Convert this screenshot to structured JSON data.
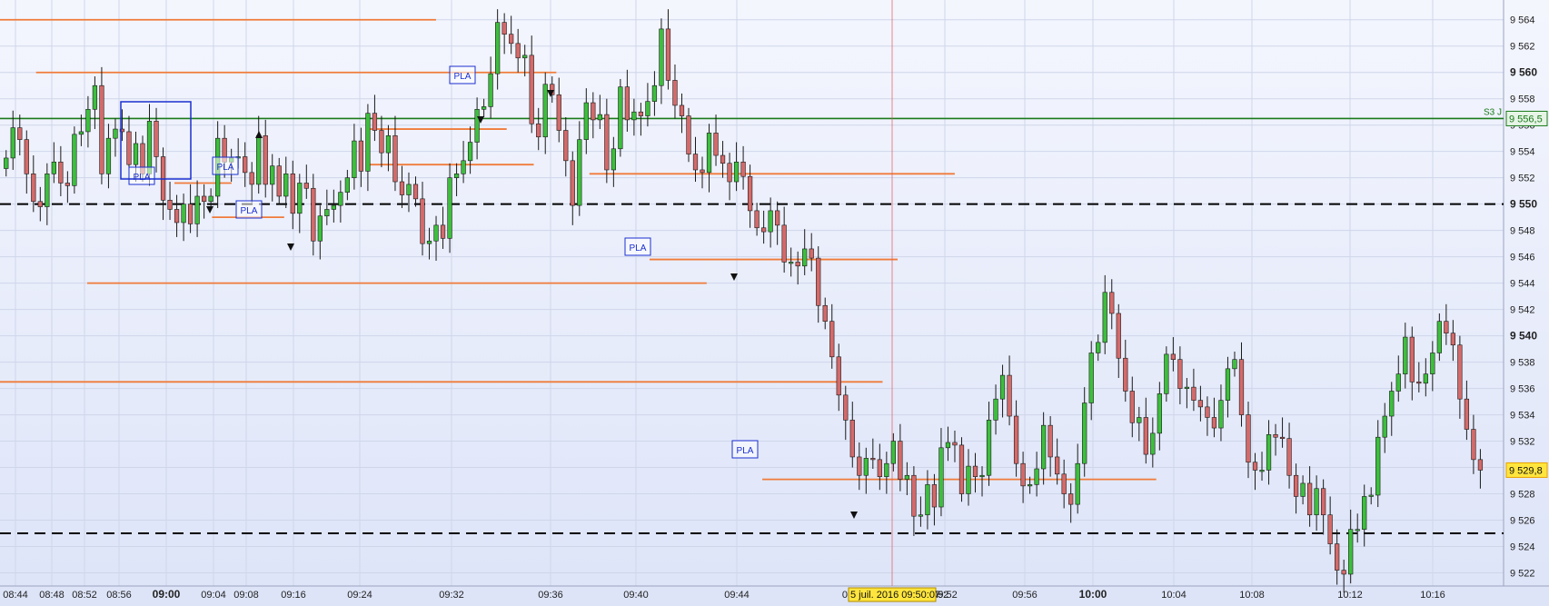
{
  "chart_data": {
    "type": "candlestick",
    "ylim": [
      9521,
      9565.5
    ],
    "y_ticks": [
      9522,
      9524,
      9526,
      9528,
      9530,
      9532,
      9534,
      9536,
      9538,
      9540,
      9542,
      9544,
      9546,
      9548,
      9550,
      9552,
      9554,
      9556,
      9558,
      9560,
      9562,
      9564
    ],
    "y_tick_labels": [
      "9 522",
      "9 524",
      "9 526",
      "9 528",
      "9 530",
      "9 532",
      "9 534",
      "9 536",
      "9 538",
      "9 540",
      "9 542",
      "9 544",
      "9 546",
      "9 548",
      "9 550",
      "9 552",
      "9 554",
      "9 556",
      "9 558",
      "9 560",
      "9 562",
      "9 564"
    ],
    "y_bold_ticks": [
      9540,
      9550,
      9560
    ],
    "x_tick_labels": [
      {
        "label": "08:44",
        "bold": false
      },
      {
        "label": "08:48",
        "bold": false
      },
      {
        "label": "08:52",
        "bold": false
      },
      {
        "label": "08:56",
        "bold": false
      },
      {
        "label": "09:00",
        "bold": true
      },
      {
        "label": "09:04",
        "bold": false
      },
      {
        "label": "09:08",
        "bold": false
      },
      {
        "label": "09:16",
        "bold": false
      },
      {
        "label": "09:24",
        "bold": false
      },
      {
        "label": "09:32",
        "bold": false
      },
      {
        "label": "09:36",
        "bold": false
      },
      {
        "label": "09:40",
        "bold": false
      },
      {
        "label": "09:44",
        "bold": false
      },
      {
        "label": "09:52",
        "bold": false
      },
      {
        "label": "09:56",
        "bold": false
      },
      {
        "label": "10:00",
        "bold": true
      },
      {
        "label": "10:04",
        "bold": false
      },
      {
        "label": "10:08",
        "bold": false
      },
      {
        "label": "10:12",
        "bold": false
      },
      {
        "label": "10:16",
        "bold": false
      }
    ],
    "x_labels_prefix": "09:",
    "close_values": [
      9553.5,
      9555.8,
      9554.9,
      9552.3,
      9550.2,
      9549.8,
      9552.3,
      9553.2,
      9551.6,
      9551.4,
      9555.3,
      9555.5,
      9557.2,
      9559,
      9552.3,
      9555,
      9555.7,
      9555.5,
      9553,
      9554.6,
      9552.3,
      9556.3,
      9553.6,
      9550.3,
      9549.6,
      9548.6,
      9550,
      9548.5,
      9550.6,
      9550.2,
      9550.6,
      9555,
      9553.2,
      9553.5,
      9553.6,
      9552.4,
      9551.5,
      9555.2,
      9551.5,
      9552.9,
      9550.6,
      9552.3,
      9549.3,
      9551.6,
      9551.2,
      9547.2,
      9549.1,
      9549.6,
      9549.9,
      9550.9,
      9552,
      9554.8,
      9552.5,
      9556.9,
      9555.6,
      9553.9,
      9555.2,
      9551.7,
      9550.7,
      9551.5,
      9550.4,
      9547,
      9547.2,
      9548.4,
      9547.4,
      9552,
      9552.3,
      9553.3,
      9554.7,
      9557.2,
      9557.4,
      9559.9,
      9563.8,
      9562.9,
      9562.2,
      9561.1,
      9561.3,
      9556.1,
      9555.1,
      9559.1,
      9558.3,
      9555.6,
      9553.3,
      9549.9,
      9554.9,
      9557.7,
      9556.4,
      9556.8,
      9552.6,
      9554.2,
      9558.9,
      9556.4,
      9557,
      9556.7,
      9557.8,
      9559,
      9563.3,
      9559.4,
      9557.5,
      9556.7,
      9553.8,
      9552.6,
      9552.4,
      9555.4,
      9553.7,
      9553.1,
      9551.7,
      9553.2,
      9552.1,
      9549.5,
      9548.2,
      9547.9,
      9549.5,
      9548.4,
      9545.6,
      9545.6,
      9545.3,
      9546.6,
      9545.9,
      9542.3,
      9541.1,
      9538.4,
      9535.5,
      9533.6,
      9530.8,
      9529.4,
      9530.7,
      9530.6,
      9529.3,
      9530.3,
      9532,
      9529.1,
      9529.4,
      9526.3,
      9526.4,
      9528.7,
      9527,
      9531.5,
      9531.9,
      9531.7,
      9528,
      9530.1,
      9529.3,
      9529.4,
      9533.6,
      9535.2,
      9537,
      9533.9,
      9530.3,
      9528.6,
      9528.7,
      9529.9,
      9533.2,
      9530.8,
      9529.5,
      9528,
      9527.2,
      9530.3,
      9534.9,
      9538.7,
      9539.5,
      9543.3,
      9541.7,
      9538.3,
      9535.8,
      9533.4,
      9533.8,
      9531,
      9532.6,
      9535.6,
      9538.6,
      9538.2,
      9536,
      9536.1,
      9535.1,
      9534.6,
      9533.8,
      9533,
      9535.1,
      9537.5,
      9538.2,
      9534,
      9530.4,
      9529.8,
      9529.8,
      9532.5,
      9532.3,
      9532.2,
      9529.4,
      9527.8,
      9528.8,
      9526.4,
      9528.4,
      9526.4,
      9524.2,
      9522.2,
      9521.9,
      9525.3,
      9525.3,
      9527.8,
      9527.9,
      9532.3,
      9533.9,
      9535.8,
      9537.1,
      9539.9,
      9536.5,
      9536.4,
      9537.1,
      9538.7,
      9541.1,
      9540.2,
      9539.3,
      9535.2,
      9532.9,
      9530.6,
      9529.8
    ],
    "reference_lines": [
      {
        "name": "S3 J",
        "value": 9556.5,
        "style": "solid",
        "color": "#1a7a1a"
      },
      {
        "name": "",
        "value": 9550,
        "style": "dashed",
        "color": "#000000"
      },
      {
        "name": "",
        "value": 9525,
        "style": "dashed",
        "color": "#000000"
      }
    ],
    "level_lines": [
      {
        "value": 9564,
        "x0": 0.0,
        "x1": 0.29
      },
      {
        "value": 9560,
        "x0": 0.024,
        "x1": 0.37
      },
      {
        "value": 9555.7,
        "x0": 0.245,
        "x1": 0.337
      },
      {
        "value": 9553,
        "x0": 0.245,
        "x1": 0.355
      },
      {
        "value": 9552.3,
        "x0": 0.392,
        "x1": 0.635
      },
      {
        "value": 9551.6,
        "x0": 0.116,
        "x1": 0.154
      },
      {
        "value": 9549,
        "x0": 0.141,
        "x1": 0.189
      },
      {
        "value": 9545.8,
        "x0": 0.432,
        "x1": 0.597
      },
      {
        "value": 9544,
        "x0": 0.058,
        "x1": 0.47
      },
      {
        "value": 9536.5,
        "x0": 0.0,
        "x1": 0.587
      },
      {
        "value": 9529.1,
        "x0": 0.507,
        "x1": 0.769
      }
    ],
    "pla_boxes": [
      {
        "label": "PLA"
      },
      {
        "label": "PLA"
      },
      {
        "label": "PLA"
      },
      {
        "label": "PLA"
      },
      {
        "label": "PLA"
      },
      {
        "label": "PLA"
      }
    ],
    "price_tags": [
      {
        "label": "9 556,5",
        "value": 9556.5,
        "color": "#1a7a1a"
      },
      {
        "label": "9 529,8",
        "value": 9529.8,
        "color": "#e8a000"
      }
    ],
    "crosshair_time_label": "5 juil. 2016 09:50:07",
    "crosshair_prefix": "0",
    "crosshair_suffix": "52",
    "colors": {
      "background": "#e6ecfa",
      "up_body": "#3dbf3d",
      "down_body": "#d46a6a",
      "level_line": "#f07b3a",
      "pla_border": "#1a2fd0",
      "crosshair": "#e05a5a",
      "price_tag_bg": "#ffe53d"
    }
  }
}
